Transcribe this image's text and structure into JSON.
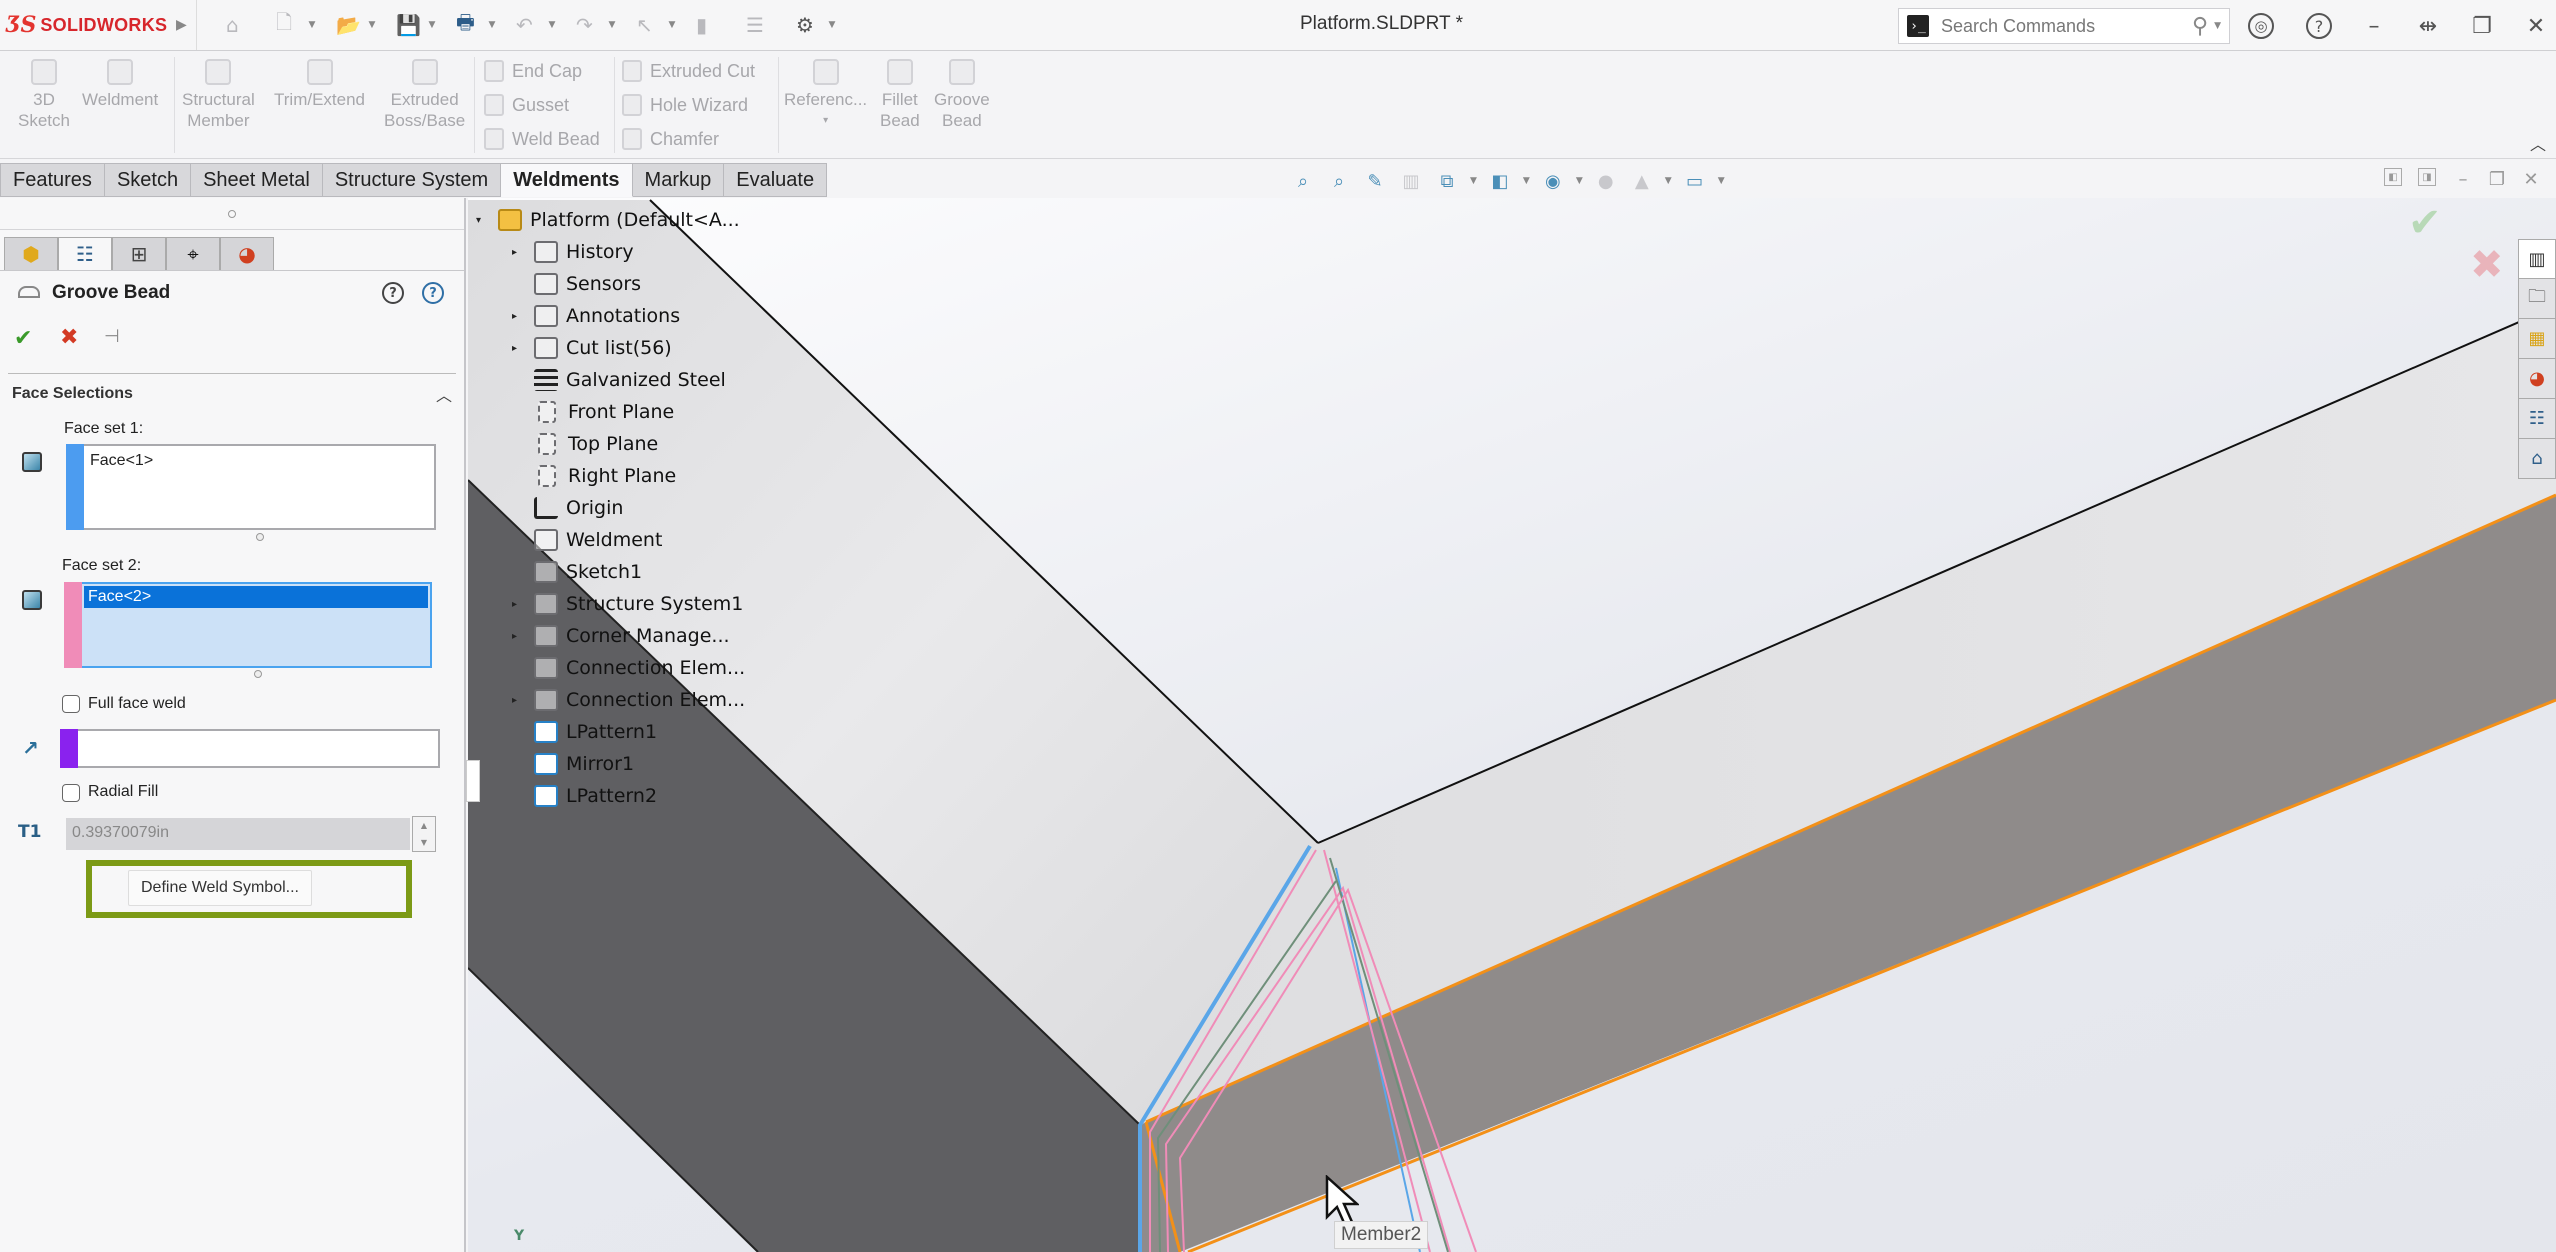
{
  "app": {
    "brand": "SOLIDWORKS",
    "document_title": "Platform.SLDPRT *"
  },
  "quick_access": [
    {
      "name": "home-icon",
      "glyph": "⌂"
    },
    {
      "name": "new-document-icon",
      "glyph": "🗋"
    },
    {
      "name": "open-icon",
      "glyph": "📂"
    },
    {
      "name": "save-icon",
      "glyph": "💾"
    },
    {
      "name": "print-icon",
      "glyph": "🖶"
    },
    {
      "name": "undo-icon",
      "glyph": "↶"
    },
    {
      "name": "redo-icon",
      "glyph": "↷"
    },
    {
      "name": "select-icon",
      "glyph": "↖"
    },
    {
      "name": "rebuild-icon",
      "glyph": "▮"
    },
    {
      "name": "file-properties-icon",
      "glyph": "☰"
    },
    {
      "name": "options-icon",
      "glyph": "⚙"
    }
  ],
  "search": {
    "placeholder": "Search Commands",
    "terminal_glyph": "›_",
    "search_glyph": "⚲"
  },
  "window_controls": {
    "account_glyph": "◎",
    "help_glyph": "?",
    "minimize_glyph": "–",
    "tile_glyph": "⇹",
    "restore_glyph": "❐",
    "close_glyph": "✕"
  },
  "ribbon": {
    "large_buttons": [
      {
        "label1": "3D",
        "label2": "Sketch"
      },
      {
        "label1": "Weldment",
        "label2": ""
      },
      {
        "label1": "Structural",
        "label2": "Member"
      },
      {
        "label1": "Trim/Extend",
        "label2": ""
      },
      {
        "label1": "Extruded",
        "label2": "Boss/Base"
      },
      {
        "label1": "Referenc...",
        "label2": "▾"
      },
      {
        "label1": "Fillet",
        "label2": "Bead"
      },
      {
        "label1": "Groove",
        "label2": "Bead"
      }
    ],
    "small_col1": [
      "End Cap",
      "Gusset",
      "Weld Bead"
    ],
    "small_col2": [
      "Extruded Cut",
      "Hole Wizard",
      "Chamfer"
    ],
    "collapse_glyph": "︿"
  },
  "tabs": [
    {
      "label": "Features",
      "active": false
    },
    {
      "label": "Sketch",
      "active": false
    },
    {
      "label": "Sheet Metal",
      "active": false
    },
    {
      "label": "Structure System",
      "active": false
    },
    {
      "label": "Weldments",
      "active": true
    },
    {
      "label": "Markup",
      "active": false
    },
    {
      "label": "Evaluate",
      "active": false
    }
  ],
  "property_manager": {
    "tabs": [
      {
        "name": "feature-manager-tab",
        "glyph": "⬢"
      },
      {
        "name": "property-manager-tab",
        "glyph": "☷"
      },
      {
        "name": "configuration-manager-tab",
        "glyph": "⊞"
      },
      {
        "name": "dimxpert-manager-tab",
        "glyph": "⌖"
      },
      {
        "name": "display-manager-tab",
        "glyph": "◕"
      }
    ],
    "title": "Groove Bead",
    "whats_new_glyph": "?",
    "help_glyph": "?",
    "ok_glyph": "✔",
    "cancel_glyph": "✖",
    "pin_glyph": "⊣",
    "section_title": "Face Selections",
    "collapse_glyph": "︿",
    "face_set_1": {
      "label": "Face set 1:",
      "items": [
        "Face<1>"
      ],
      "color": "#4c9cf0"
    },
    "face_set_2": {
      "label": "Face set 2:",
      "items": [
        "Face<2>"
      ],
      "color": "#f08cb8"
    },
    "full_face_weld": {
      "label": "Full face weld",
      "checked": false
    },
    "direction": {
      "value": "",
      "color": "#8a22ee",
      "glyph": "↗"
    },
    "radial_fill": {
      "label": "Radial Fill",
      "checked": false
    },
    "thickness": {
      "value": "0.39370079in",
      "icon_text": "T1"
    },
    "define_weld_symbol_label": "Define Weld Symbol..."
  },
  "feature_tree": [
    {
      "label": "Platform  (Default<A...",
      "icon": "part",
      "expander": "▾",
      "level": 0
    },
    {
      "label": "History",
      "icon": "folder",
      "expander": "▸",
      "level": 1
    },
    {
      "label": "Sensors",
      "icon": "folder",
      "expander": "",
      "level": 1
    },
    {
      "label": "Annotations",
      "icon": "folder",
      "expander": "▸",
      "level": 1
    },
    {
      "label": "Cut list(56)",
      "icon": "folder",
      "expander": "▸",
      "level": 1
    },
    {
      "label": "Galvanized Steel",
      "icon": "mat",
      "expander": "",
      "level": 1
    },
    {
      "label": "Front Plane",
      "icon": "plane",
      "expander": "",
      "level": 1
    },
    {
      "label": "Top Plane",
      "icon": "plane",
      "expander": "",
      "level": 1
    },
    {
      "label": "Right Plane",
      "icon": "plane",
      "expander": "",
      "level": 1
    },
    {
      "label": "Origin",
      "icon": "origin",
      "expander": "",
      "level": 1
    },
    {
      "label": "Weldment",
      "icon": "folder",
      "expander": "",
      "level": 1
    },
    {
      "label": "Sketch1",
      "icon": "folder",
      "expander": "",
      "level": 1
    },
    {
      "label": "Structure System1",
      "icon": "folder",
      "expander": "▸",
      "level": 1
    },
    {
      "label": "Corner Manage...",
      "icon": "folder",
      "expander": "▸",
      "level": 1
    },
    {
      "label": "Connection Elem...",
      "icon": "folder",
      "expander": "",
      "level": 1
    },
    {
      "label": "Connection Elem...",
      "icon": "folder",
      "expander": "▸",
      "level": 1
    },
    {
      "label": "LPattern1",
      "icon": "pat",
      "expander": "",
      "level": 1
    },
    {
      "label": "Mirror1",
      "icon": "pat",
      "expander": "",
      "level": 1
    },
    {
      "label": "LPattern2",
      "icon": "pat",
      "expander": "",
      "level": 1
    }
  ],
  "heads_up_toolbar": [
    {
      "name": "zoom-to-fit-icon",
      "glyph": "⌕",
      "dim": false,
      "dd": false
    },
    {
      "name": "zoom-to-area-icon",
      "glyph": "⌕",
      "dim": false,
      "dd": false
    },
    {
      "name": "previous-view-icon",
      "glyph": "✎",
      "dim": false,
      "dd": false
    },
    {
      "name": "section-view-icon",
      "glyph": "▥",
      "dim": true,
      "dd": false
    },
    {
      "name": "view-orientation-icon",
      "glyph": "⧉",
      "dim": false,
      "dd": true
    },
    {
      "name": "display-style-icon",
      "glyph": "◧",
      "dim": false,
      "dd": true
    },
    {
      "name": "hide-show-items-icon",
      "glyph": "◉",
      "dim": false,
      "dd": true
    },
    {
      "name": "edit-appearance-icon",
      "glyph": "●",
      "dim": true,
      "dd": false
    },
    {
      "name": "apply-scene-icon",
      "glyph": "▲",
      "dim": true,
      "dd": true
    },
    {
      "name": "view-settings-icon",
      "glyph": "▭",
      "dim": false,
      "dd": true
    }
  ],
  "viewport_controls": {
    "prev_glyph": "◧",
    "next_glyph": "◨",
    "minimize_glyph": "–",
    "restore_glyph": "❐",
    "close_glyph": "✕"
  },
  "confirmation_corner": {
    "ok_glyph": "✔",
    "cancel_glyph": "✖"
  },
  "task_pane": [
    {
      "name": "solidworks-resources-icon",
      "glyph": "▥"
    },
    {
      "name": "design-library-icon",
      "glyph": "🗀"
    },
    {
      "name": "file-explorer-icon",
      "glyph": "▦"
    },
    {
      "name": "appearances-icon",
      "glyph": "◕"
    },
    {
      "name": "custom-properties-icon",
      "glyph": "☷"
    },
    {
      "name": "home-icon",
      "glyph": "⌂"
    }
  ],
  "graphics": {
    "tooltip": "Member2",
    "triad_label": "Y",
    "highlight_color": "#f39018",
    "face_set_1_color": "#4c9cf0",
    "face_set_2_color": "#f08cb8"
  }
}
